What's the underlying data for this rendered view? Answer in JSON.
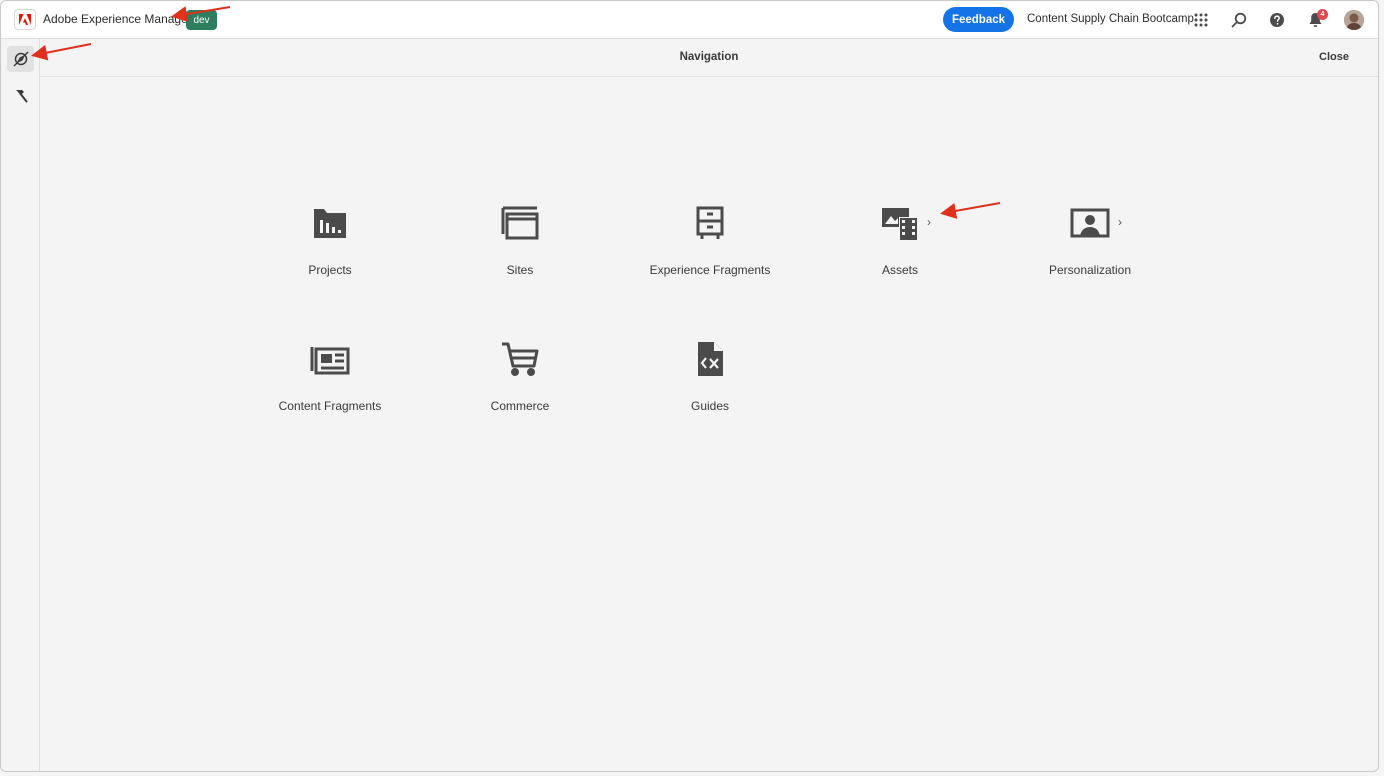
{
  "header": {
    "app_title": "Adobe Experience Manager",
    "env_badge": "dev",
    "feedback_label": "Feedback",
    "org_name": "Content Supply Chain Bootcamp",
    "notification_count": "4",
    "icons": [
      "adobe-logo",
      "apps-grid-icon",
      "search-icon",
      "help-icon",
      "bell-icon",
      "avatar"
    ]
  },
  "rail": {
    "items": [
      {
        "icon": "navigation-compass-icon",
        "active": true
      },
      {
        "icon": "tools-hammer-icon",
        "active": false
      }
    ]
  },
  "navigation": {
    "title": "Navigation",
    "close_label": "Close"
  },
  "tiles": [
    {
      "label": "Projects",
      "icon": "projects-icon",
      "has_children": false
    },
    {
      "label": "Sites",
      "icon": "sites-icon",
      "has_children": false
    },
    {
      "label": "Experience Fragments",
      "icon": "experience-fragments-icon",
      "has_children": false
    },
    {
      "label": "Assets",
      "icon": "assets-icon",
      "has_children": true
    },
    {
      "label": "Personalization",
      "icon": "personalization-icon",
      "has_children": true
    },
    {
      "label": "Content Fragments",
      "icon": "content-fragments-icon",
      "has_children": false
    },
    {
      "label": "Commerce",
      "icon": "commerce-cart-icon",
      "has_children": false
    },
    {
      "label": "Guides",
      "icon": "guides-icon",
      "has_children": false
    }
  ],
  "colors": {
    "accent": "#1473e6",
    "env_badge": "#2d7e5e",
    "notification": "#e34850",
    "annotation_arrow": "#e0301e"
  }
}
